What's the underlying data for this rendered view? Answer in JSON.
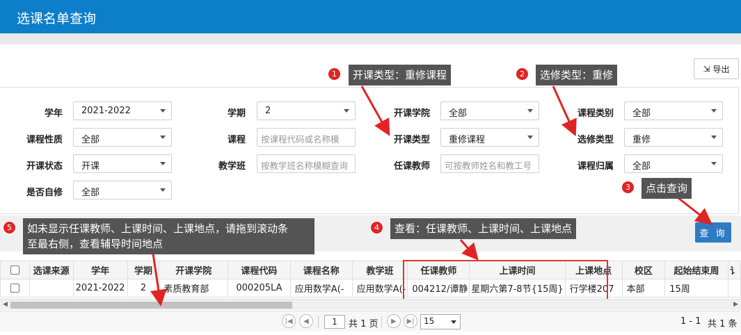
{
  "header": {
    "title": "选课名单查询"
  },
  "toolbar": {
    "export_label": "导出",
    "export_icon": "export-icon"
  },
  "form": {
    "row1": {
      "year_label": "学年",
      "year_value": "2021-2022",
      "term_label": "学期",
      "term_value": "2",
      "college_label": "开课学院",
      "college_value": "全部",
      "category_label": "课程类别",
      "category_value": "全部"
    },
    "row2": {
      "nature_label": "课程性质",
      "nature_value": "全部",
      "course_label": "课程",
      "course_placeholder": "按课程代码或名称模",
      "open_type_label": "开课类型",
      "open_type_value": "重修课程",
      "select_type_label": "选修类型",
      "select_type_value": "重修"
    },
    "row3": {
      "status_label": "开课状态",
      "status_value": "开课",
      "class_label": "教学班",
      "class_placeholder": "按教学班名称模糊查询",
      "teacher_label": "任课教师",
      "teacher_placeholder": "可按教师姓名和教工号",
      "belong_label": "课程归属",
      "belong_value": "全部"
    },
    "row4": {
      "self_study_label": "是否自修",
      "self_study_value": "全部"
    },
    "query_label": "查 询"
  },
  "callouts": [
    {
      "num": "1",
      "text": "开课类型：重修课程"
    },
    {
      "num": "2",
      "text": "选修类型：重修"
    },
    {
      "num": "3",
      "text": "点击查询"
    },
    {
      "num": "4",
      "text": "查看：任课教师、上课时间、上课地点"
    },
    {
      "num": "5",
      "text_line1": "如未显示任课教师、上课时间、上课地点，请拖到滚动条",
      "text_line2": "至最右侧，查看辅导时间地点"
    }
  ],
  "table": {
    "headers": [
      "选课来源",
      "学年",
      "学期",
      "开课学院",
      "课程代码",
      "课程名称",
      "教学班",
      "任课教师",
      "上课时间",
      "上课地点",
      "校区",
      "起始结束周",
      "讠"
    ],
    "rows": [
      [
        "",
        "2021-2022",
        "2",
        "素质教育部",
        "000205LA",
        "应用数学A(-",
        "应用数学A(-",
        "004212/谭静",
        "星期六第7-8节{15周}",
        "行学楼207",
        "本部",
        "15周",
        ""
      ]
    ]
  },
  "pager": {
    "page_value": "1",
    "total_pages_text": "共 1 页",
    "page_size": "15",
    "range_text": "1 - 1",
    "total_text": "共 1 条"
  },
  "colors": {
    "header_bg": "#0d7ec9",
    "accent_red": "#e02424",
    "query_btn": "#2e7bc4",
    "callout_bg": "#545454"
  }
}
